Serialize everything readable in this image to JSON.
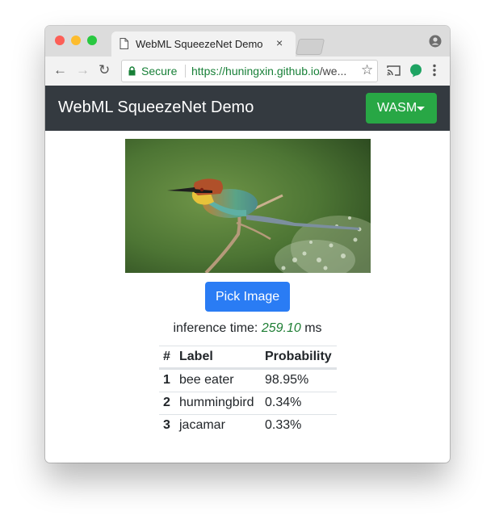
{
  "browser": {
    "tab_title": "WebML SqueezeNet Demo",
    "tab_close": "×",
    "secure_label": "Secure",
    "url_scheme": "https://",
    "url_host": "huningxin.github.io",
    "url_rest": "/we..."
  },
  "navbar": {
    "brand": "WebML SqueezeNet Demo",
    "backend_label": "WASM"
  },
  "main": {
    "pick_image_label": "Pick Image",
    "inference_prefix": "inference time:",
    "inference_value": "259.10",
    "inference_unit": "ms"
  },
  "results": {
    "headers": [
      "#",
      "Label",
      "Probability"
    ],
    "rows": [
      {
        "rank": "1",
        "label": "bee eater",
        "probability": "98.95%"
      },
      {
        "rank": "2",
        "label": "hummingbird",
        "probability": "0.34%"
      },
      {
        "rank": "3",
        "label": "jacamar",
        "probability": "0.33%"
      }
    ]
  },
  "colors": {
    "navbar_bg": "#343a40",
    "backend_button": "#28a745",
    "pick_button": "#2a7cf4",
    "inference_value": "#1e7e34",
    "secure": "#188038"
  }
}
